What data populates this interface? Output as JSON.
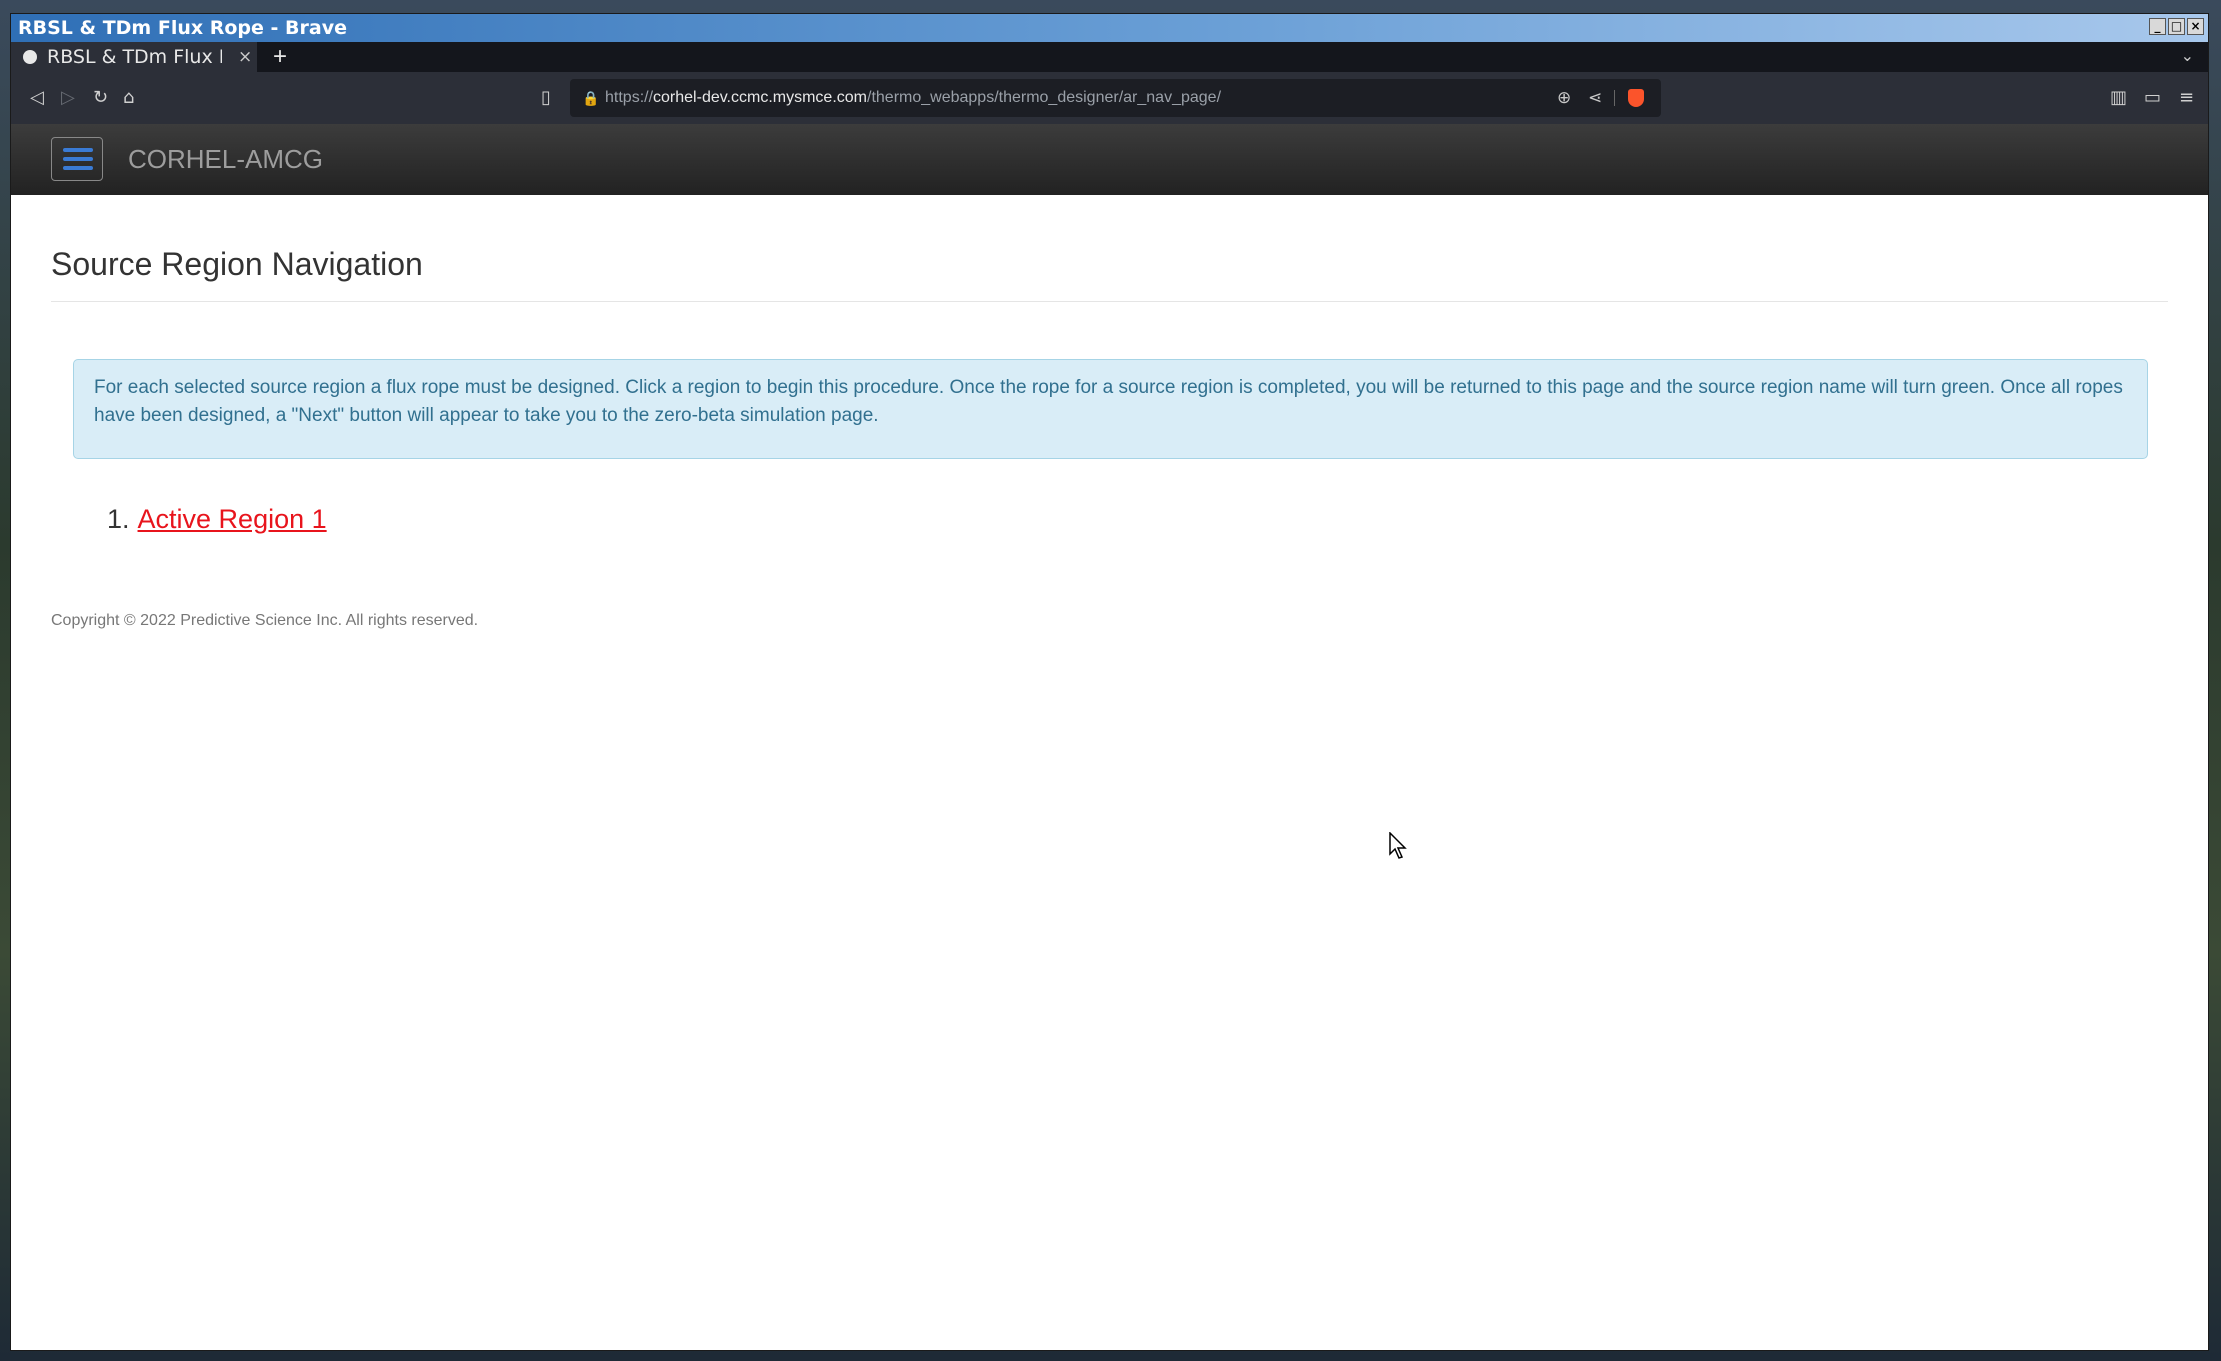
{
  "window": {
    "title": "RBSL & TDm Flux Rope - Brave",
    "controls": [
      "_",
      "□",
      "×"
    ]
  },
  "tabs": [
    {
      "title": "RBSL & TDm Flux Rope - Brave",
      "close": "×"
    }
  ],
  "tabstrip": {
    "new_tab": "+",
    "overflow": "⌄"
  },
  "toolbar": {
    "url_scheme": "https://",
    "url_host": "corhel-dev.ccmc.mysmce.com",
    "url_path": "/thermo_webapps/thermo_designer/ar_nav_page/",
    "icons": [
      "back-icon",
      "forward-icon",
      "reload-icon",
      "home-icon",
      "bookmark-icon",
      "lock-icon",
      "zoom-icon",
      "share-icon",
      "brave-shields-icon",
      "sidebar-icon",
      "wallet-icon",
      "menu-icon"
    ]
  },
  "navbar": {
    "brand": "CORHEL-AMCG"
  },
  "page": {
    "title": "Source Region Navigation",
    "info": "For each selected source region a flux rope must be designed. Click a region to begin this procedure. Once the rope for a source region is completed, you will be returned to this page and the source region name will turn green. Once all ropes have been designed, a \"Next\" button will appear to take you to the zero-beta simulation page.",
    "regions": [
      {
        "number": "1.",
        "name": "Active Region 1"
      }
    ],
    "footer": "Copyright © 2022 Predictive Science Inc. All rights reserved."
  },
  "colors": {
    "region_link": "#e8141c",
    "alert_bg": "#d9edf7",
    "alert_text": "#31708f",
    "navbar_bg": "#222222"
  }
}
